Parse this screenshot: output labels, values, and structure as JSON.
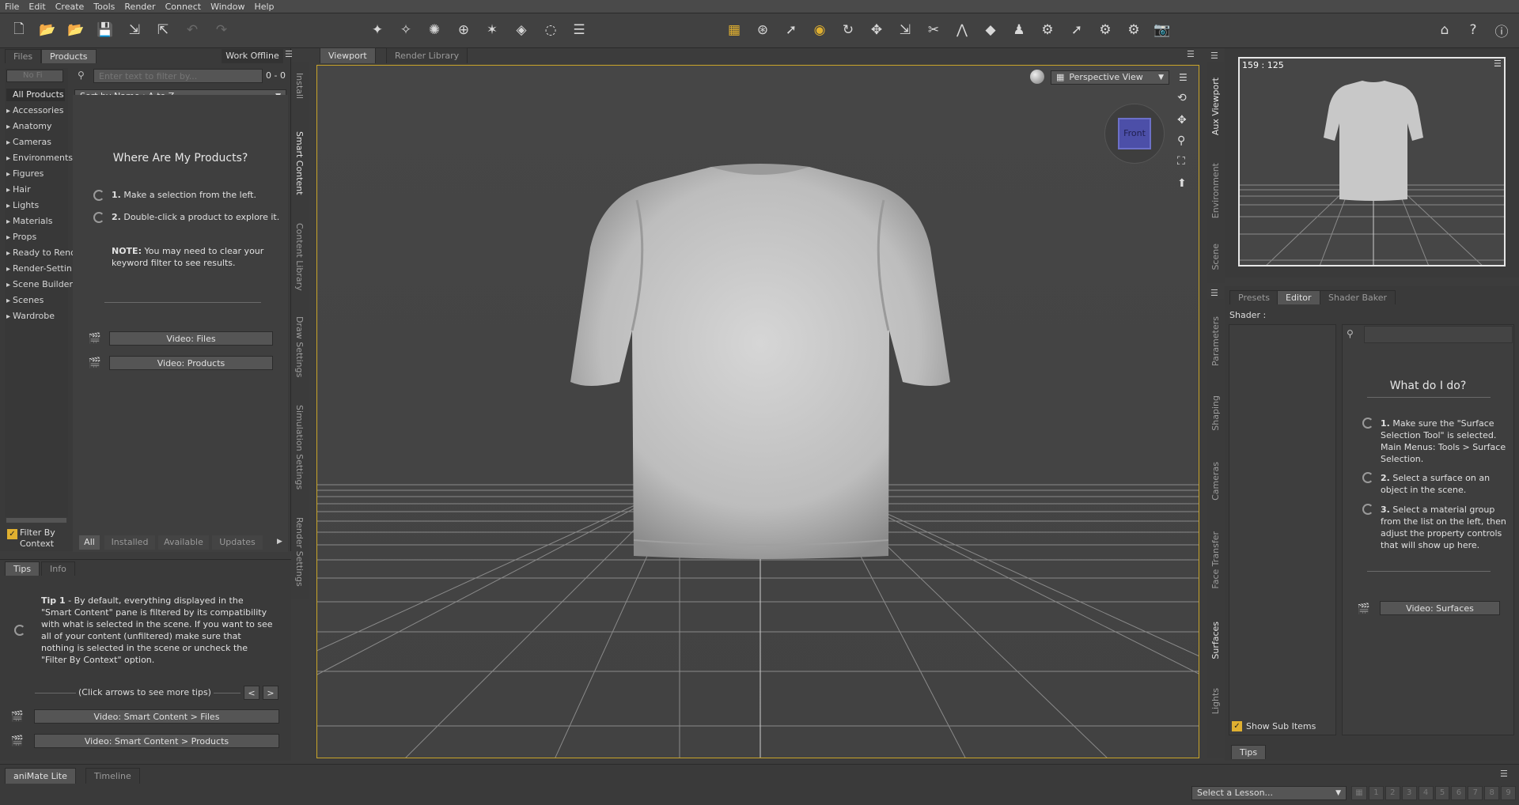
{
  "menu": [
    "File",
    "Edit",
    "Create",
    "Tools",
    "Render",
    "Connect",
    "Window",
    "Help"
  ],
  "left_panel": {
    "tabs": [
      "Files",
      "Products"
    ],
    "work_offline": "Work Offline",
    "no_filter": "No Fi",
    "all_products": "All Products",
    "search_placeholder": "Enter text to filter by...",
    "count": "0 - 0",
    "sort": "Sort by Name : A to Z",
    "categories": [
      "Accessories",
      "Anatomy",
      "Cameras",
      "Environments",
      "Figures",
      "Hair",
      "Lights",
      "Materials",
      "Props",
      "Ready to Rend",
      "Render-Settin",
      "Scene Builder",
      "Scenes",
      "Wardrobe"
    ],
    "where_title": "Where Are My Products?",
    "step1_num": "1.",
    "step1": "Make a selection from the left.",
    "step2_num": "2.",
    "step2": "Double-click a product to explore it.",
    "note_label": "NOTE:",
    "note": "You may need to clear your keyword filter to see results.",
    "video_files": "Video: Files",
    "video_products": "Video: Products",
    "filter_by_context": "Filter By Context",
    "filter_tabs": [
      "All",
      "Installed",
      "Available",
      "Updates"
    ]
  },
  "left_vtabs": [
    "Install",
    "Smart Content",
    "Content Library",
    "Draw Settings",
    "Simulation Settings",
    "Render Settings"
  ],
  "tips_panel": {
    "tabs": [
      "Tips",
      "Info"
    ],
    "tip_label": "Tip 1",
    "tip_text": " - By default, everything displayed in the \"Smart Content\" pane is filtered by its compatibility with what is selected in the scene. If you want to see all of your content (unfiltered) make sure that nothing is selected in the scene or uncheck the \"Filter By Context\" option.",
    "click_arrows": "(Click arrows to see more tips)",
    "prev": "<",
    "next": ">",
    "video_sc_files": "Video: Smart Content > Files",
    "video_sc_products": "Video: Smart Content > Products"
  },
  "viewport": {
    "tabs": [
      "Viewport",
      "Render Library"
    ],
    "view_name": "Perspective View",
    "cube_label": "Front"
  },
  "aux": {
    "coords": "159 : 125"
  },
  "right_vtabs_top": [
    "Aux Viewport",
    "Environment",
    "Scene"
  ],
  "right_vtabs_bottom": [
    "Parameters",
    "Shaping",
    "Cameras",
    "Face Transfer",
    "Surfaces",
    "Lights"
  ],
  "surfaces": {
    "tabs": [
      "Presets",
      "Editor",
      "Shader Baker"
    ],
    "shader_label": "Shader :",
    "what_title": "What do I do?",
    "step1_num": "1.",
    "step1": "Make sure the \"Surface Selection Tool\" is selected. Main Menus: Tools > Surface Selection.",
    "step2_num": "2.",
    "step2": "Select a surface on an object in the scene.",
    "step3_num": "3.",
    "step3": "Select a material group from the list on the left, then adjust the property controls that will show up here.",
    "video_surfaces": "Video: Surfaces",
    "show_sub_items": "Show Sub Items",
    "tips_tab": "Tips"
  },
  "bottom": {
    "tabs": [
      "aniMate Lite",
      "Timeline"
    ],
    "lesson": "Select a Lesson...",
    "steps": [
      "1",
      "2",
      "3",
      "4",
      "5",
      "6",
      "7",
      "8",
      "9"
    ]
  },
  "colors": {
    "accent": "#c9a52a",
    "background": "#3c3c3c",
    "active_tool": "#e0b030"
  }
}
